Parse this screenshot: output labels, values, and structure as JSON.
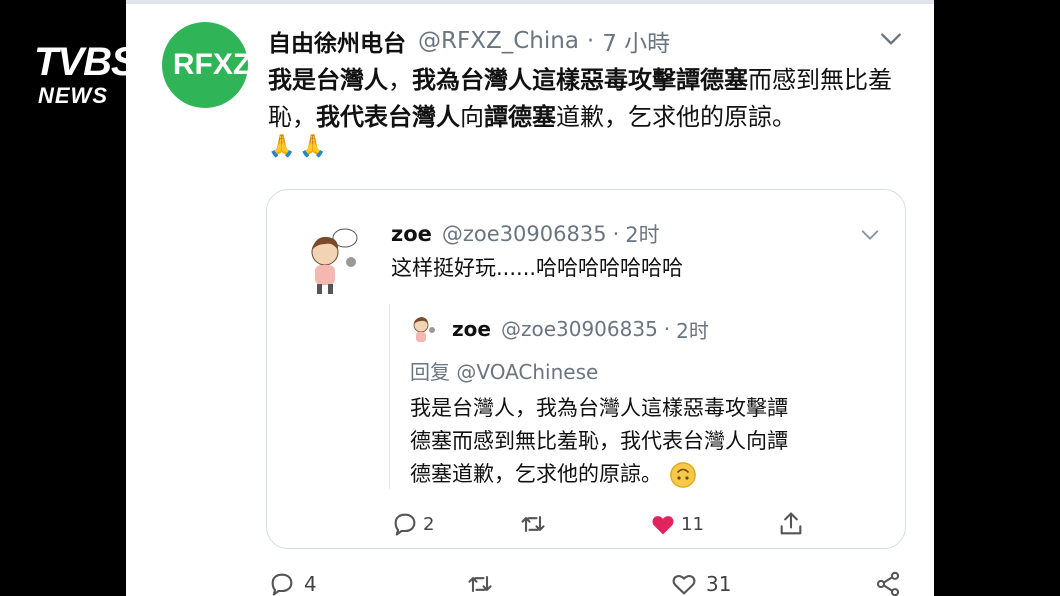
{
  "overlay": {
    "logo_main": "TVBS",
    "logo_sub": "NEWS"
  },
  "tweet": {
    "avatar_text": "RFXZ",
    "author_name": "自由徐州电台",
    "author_handle": "@RFXZ_China",
    "separator": "·",
    "time": "7 小時",
    "text_parts": [
      {
        "text": "我是",
        "bold": true
      },
      {
        "text": "台灣人",
        "bold": true
      },
      {
        "text": "，",
        "bold": false
      },
      {
        "text": "我為",
        "bold": true
      },
      {
        "text": "台灣人這樣惡毒攻擊譚德塞",
        "bold": true
      },
      {
        "text": "而感到無比羞恥，",
        "bold": false
      },
      {
        "text": "我代表",
        "bold": true
      },
      {
        "text": "台灣人",
        "bold": true
      },
      {
        "text": "向",
        "bold": false
      },
      {
        "text": "譚德塞",
        "bold": true
      },
      {
        "text": "道歉，乞求他的原諒。",
        "bold": false
      }
    ],
    "emojis": "🙏🙏",
    "stats": {
      "replies": "4",
      "likes": "31"
    }
  },
  "quote": {
    "author_name": "zoe",
    "author_handle": "@zoe30906835",
    "separator": "·",
    "time": "2时",
    "text": "这样挺好玩......哈哈哈哈哈哈哈",
    "inner": {
      "author_name": "zoe",
      "author_handle": "@zoe30906835",
      "separator": "·",
      "time": "2时",
      "reply_label": "回复",
      "reply_to": "@VOAChinese",
      "lines": [
        "我是台灣人，我為台灣人這樣惡毒攻擊譚",
        "德塞而感到無比羞恥，我代表台灣人向譚",
        "德塞道歉，乞求他的原諒。"
      ]
    },
    "stats": {
      "replies": "2",
      "likes": "11"
    }
  },
  "colors": {
    "avatar_green": "#2fb457",
    "like_red": "#e0245e",
    "muted_gray": "#6b7580"
  },
  "icons": [
    "chevron-down-icon",
    "reply-icon",
    "retweet-icon",
    "like-icon",
    "share-icon"
  ]
}
